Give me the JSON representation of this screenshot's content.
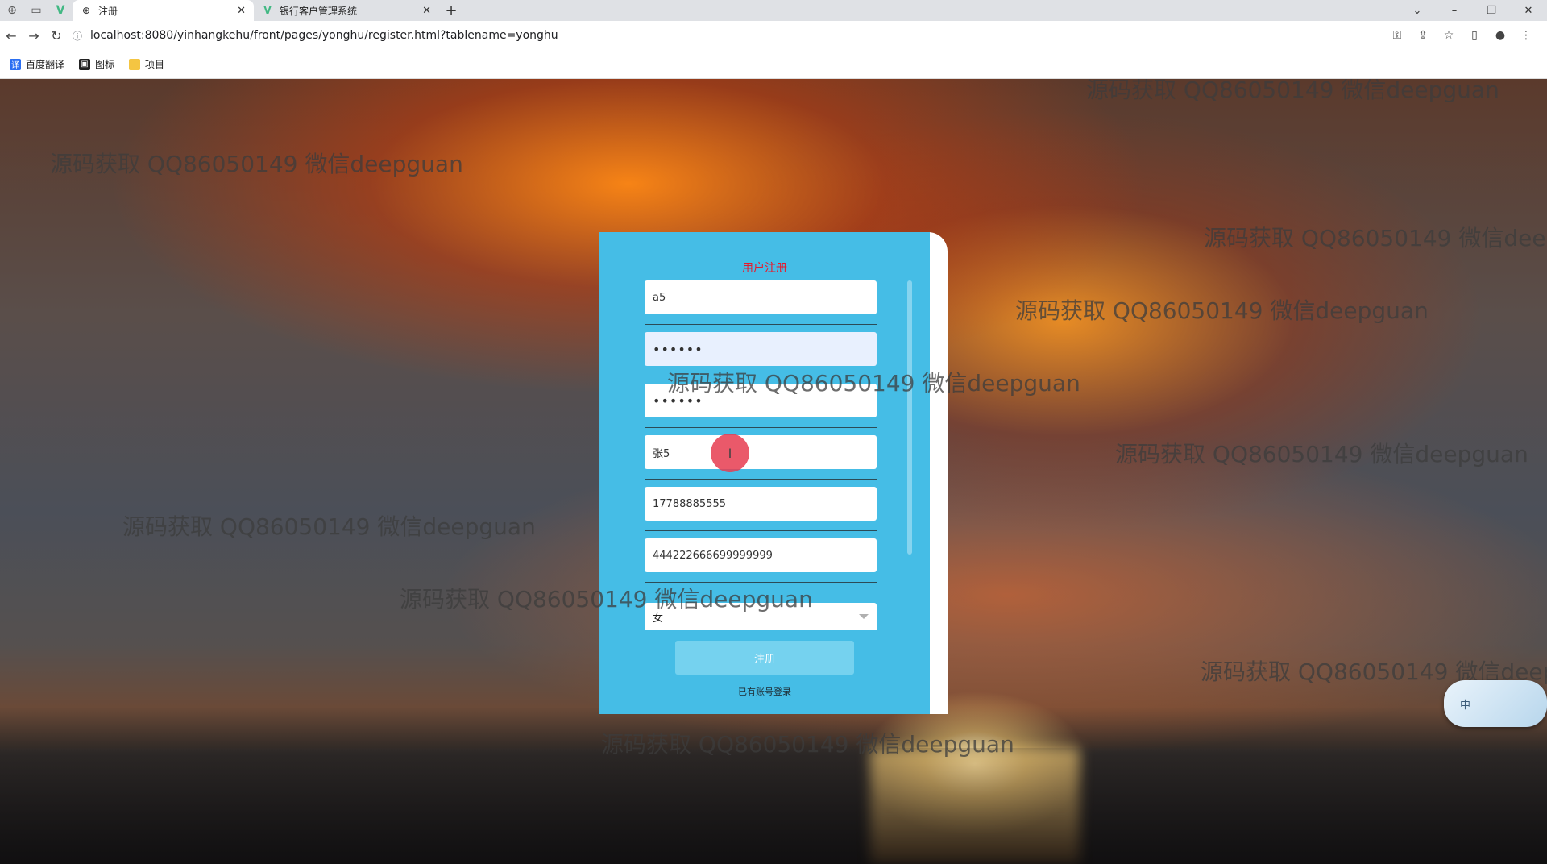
{
  "browser": {
    "tabs": [
      {
        "title": "注册",
        "active": true
      },
      {
        "title": "银行客户管理系统",
        "active": false
      }
    ],
    "url": "localhost:8080/yinhangkehu/front/pages/yonghu/register.html?tablename=yonghu",
    "bookmarks": [
      "百度翻译",
      "图标",
      "项目"
    ]
  },
  "watermark_text": "源码获取 QQ86050149 微信deepguan",
  "form": {
    "title": "用户注册",
    "fields": {
      "username": "a5",
      "password": "••••••",
      "confirm_password": "••••••",
      "name": "张5",
      "phone": "17788885555",
      "id_number": "444222666699999999"
    },
    "gender": "女",
    "submit_label": "注册",
    "login_link": "已有账号登录"
  },
  "ime_indicator": "中",
  "colors": {
    "card_bg": "#45bde6",
    "title": "#e8192c",
    "button": "#75d2ef"
  }
}
